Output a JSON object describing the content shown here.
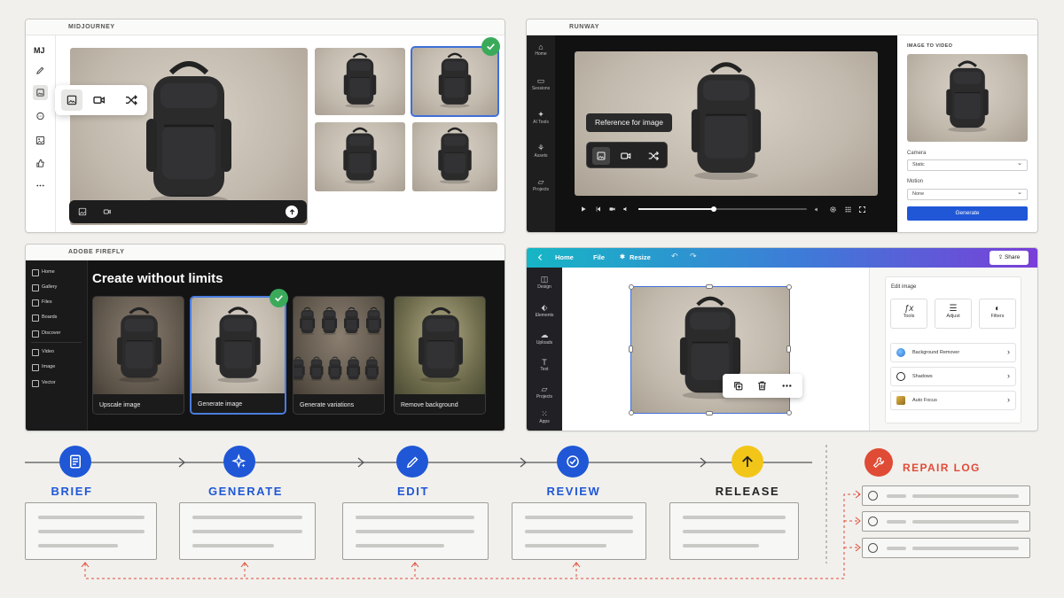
{
  "colors": {
    "background": "#f1f0ed",
    "blue": "#1f57d6",
    "green_check": "#3aaa5a",
    "repair_red": "#e04b35",
    "release_yellow": "#f2c618"
  },
  "midjourney": {
    "title": "MIDJOURNEY",
    "logo": "MJ",
    "sidebar_icons": [
      "pencil-icon",
      "image-icon",
      "chat-icon",
      "gallery-icon",
      "thumbs-up-icon",
      "more-icon"
    ],
    "tool_popover_icons": [
      "image-reference-icon",
      "video-icon",
      "shuffle-icon"
    ],
    "prompt_bar_icons": [
      "image-icon",
      "video-icon",
      "submit-arrow-icon"
    ]
  },
  "runway": {
    "title": "RUNWAY",
    "nav": [
      "Home",
      "Sessions",
      "AI Tools",
      "Assets",
      "Projects"
    ],
    "tooltip": "Reference for image",
    "panel_title": "IMAGE TO VIDEO",
    "camera_label": "Camera",
    "camera_value": "Static",
    "motion_label": "Motion",
    "motion_value": "None",
    "generate_label": "Generate"
  },
  "firefly": {
    "title": "ADOBE FIREFLY",
    "nav": [
      "Home",
      "Gallery",
      "Files",
      "Boards",
      "Discover",
      "Video",
      "Image",
      "Vector"
    ],
    "heading": "Create without limits",
    "cards": [
      "Upscale image",
      "Generate image",
      "Generate variations",
      "Remove background"
    ]
  },
  "canva": {
    "back_icon": "chevron-left-icon",
    "menu": [
      "Home",
      "File",
      "Resize"
    ],
    "share_label": "Share",
    "sidebar": [
      "Design",
      "Elements",
      "Uploads",
      "Text",
      "Projects",
      "Apps"
    ],
    "panel_title": "Edit image",
    "options": [
      "Tools",
      "Adjust",
      "Filters"
    ],
    "rows": [
      "Background Remover",
      "Shadows",
      "Auto Focus"
    ]
  },
  "workflow": {
    "steps": [
      {
        "label": "BRIEF",
        "icon": "document-icon",
        "color": "#1f57d6"
      },
      {
        "label": "GENERATE",
        "icon": "sparkle-icon",
        "color": "#1f57d6"
      },
      {
        "label": "EDIT",
        "icon": "pencil-icon",
        "color": "#1f57d6"
      },
      {
        "label": "REVIEW",
        "icon": "check-circle-icon",
        "color": "#1f57d6"
      },
      {
        "label": "RELEASE",
        "icon": "up-arrow-icon",
        "color": "#f2c618"
      }
    ],
    "repair": {
      "label": "REPAIR LOG",
      "icon": "wrench-icon",
      "rows": 3
    }
  }
}
